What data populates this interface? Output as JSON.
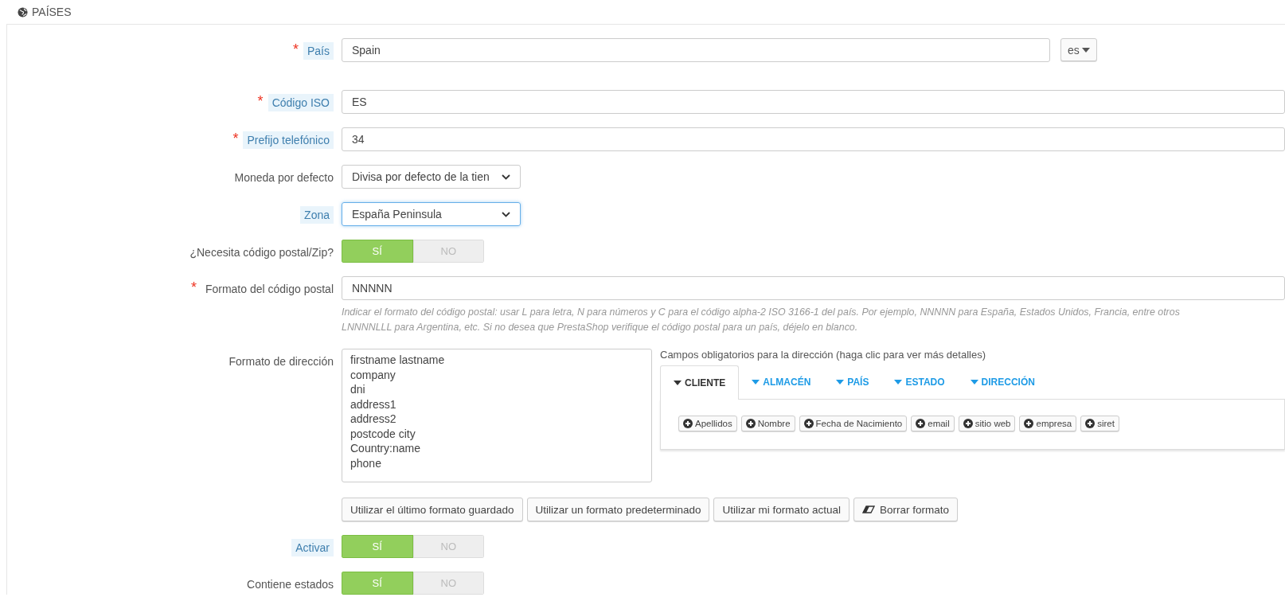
{
  "panel": {
    "title": "PAÍSES"
  },
  "fields": [
    {
      "kind": "text_lang",
      "label": "País",
      "required": "*",
      "hint": true,
      "value": "Spain",
      "language": "es"
    },
    {
      "kind": "text",
      "label": "Código ISO",
      "required": "*",
      "hint": true,
      "value": "ES"
    },
    {
      "kind": "text",
      "label": "Prefijo telefónico",
      "required": "*",
      "hint": true,
      "value": "34"
    },
    {
      "kind": "select",
      "label": "Moneda por defecto",
      "hint": false,
      "value": "Divisa por defecto de la tien",
      "focused": false
    },
    {
      "kind": "select",
      "label": "Zona",
      "hint": true,
      "value": "España Peninsula",
      "focused": true
    },
    {
      "kind": "toggle",
      "label": "¿Necesita código postal/Zip?",
      "hint": false,
      "options": [
        {
          "label": "SÍ",
          "selected": true
        },
        {
          "label": "NO",
          "selected": false
        }
      ]
    },
    {
      "kind": "text",
      "label": "Formato del código postal",
      "required": "*",
      "hint": false,
      "value": "NNNNN",
      "help": [
        "Indicar el formato del código postal: usar L para letra, N para números y C para el código alpha-2 ISO 3166-1 del país. Por ejemplo, NNNNN para España, Estados Unidos, Francia, entre otros",
        "LNNNNLLL para Argentina, etc. Si no desea que PrestaShop verifique el código postal para un país, déjelo en blanco."
      ]
    },
    {
      "kind": "address",
      "label": "Formato de dirección",
      "hint": false,
      "lines": [
        "firstname lastname",
        "company",
        "dni",
        "address1",
        "address2",
        "postcode city",
        "Country:name",
        "phone"
      ],
      "caption": "Campos obligatorios para la dirección (haga clic para ver más detalles)",
      "tabs": [
        {
          "label": "CLIENTE",
          "selected": true
        },
        {
          "label": "ALMACÉN",
          "selected": false
        },
        {
          "label": "PAÍS",
          "selected": false
        },
        {
          "label": "ESTADO",
          "selected": false
        },
        {
          "label": "DIRECCIÓN",
          "selected": false
        }
      ],
      "chips": [
        "Apellidos",
        "Nombre",
        "Fecha de Nacimiento",
        "email",
        "sitio web",
        "empresa",
        "siret"
      ],
      "buttons": [
        {
          "kind": "plain",
          "label": "Utilizar el último formato guardado"
        },
        {
          "kind": "plain",
          "label": "Utilizar un formato predeterminado"
        },
        {
          "kind": "plain",
          "label": "Utilizar mi formato actual"
        },
        {
          "kind": "clear",
          "label": "Borrar formato"
        }
      ]
    },
    {
      "kind": "toggle",
      "label": "Activar",
      "hint": true,
      "options": [
        {
          "label": "SÍ",
          "selected": true
        },
        {
          "label": "NO",
          "selected": false
        }
      ]
    },
    {
      "kind": "toggle",
      "label": "Contiene estados",
      "hint": false,
      "options": [
        {
          "label": "SÍ",
          "selected": true
        },
        {
          "label": "NO",
          "selected": false
        }
      ]
    }
  ]
}
